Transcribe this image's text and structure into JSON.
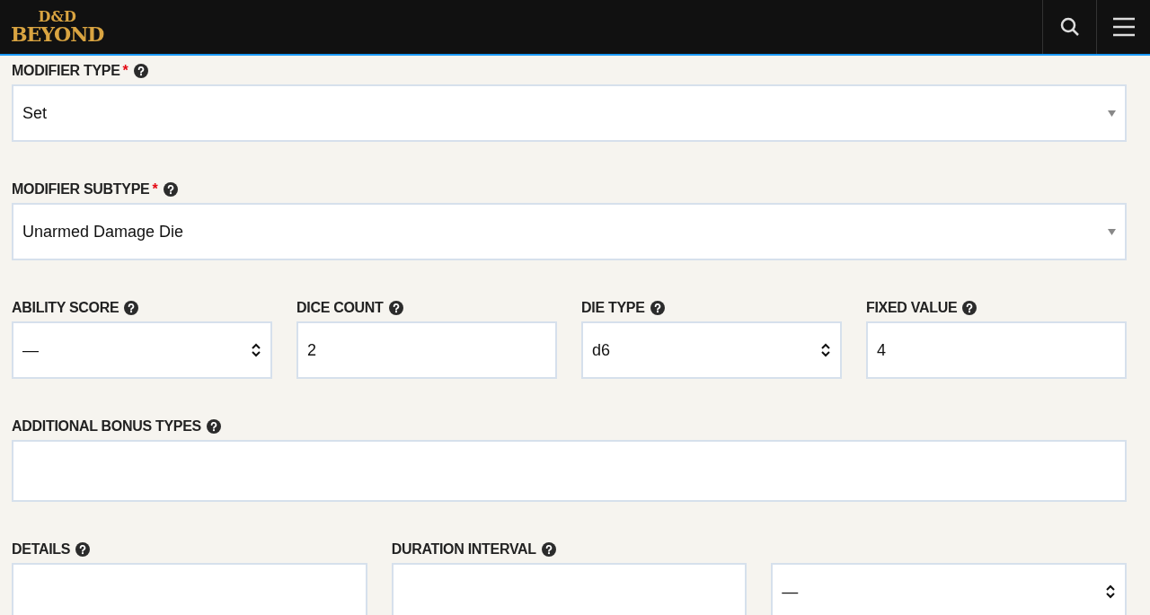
{
  "header": {
    "logo_top": "D&D",
    "logo_bottom": "BEYOND"
  },
  "rows": [
    {
      "fields": [
        {
          "label": "MODIFIER TYPE",
          "required_mark": "*",
          "kind": "dropdown",
          "value": "Set"
        }
      ]
    },
    {
      "fields": [
        {
          "label": "MODIFIER SUBTYPE",
          "required_mark": "*",
          "kind": "dropdown",
          "value": "Unarmed Damage Die"
        }
      ]
    },
    {
      "fields": [
        {
          "label": "ABILITY SCORE",
          "kind": "select",
          "value": "—"
        },
        {
          "label": "DICE COUNT",
          "kind": "input",
          "value": "2"
        },
        {
          "label": "DIE TYPE",
          "kind": "select",
          "value": "d6"
        },
        {
          "label": "FIXED VALUE",
          "kind": "input",
          "value": "4"
        }
      ]
    },
    {
      "fields": [
        {
          "label": "ADDITIONAL BONUS TYPES",
          "kind": "tags"
        }
      ]
    },
    {
      "fields": [
        {
          "label": "DETAILS",
          "kind": "input"
        },
        {
          "label": "DURATION INTERVAL",
          "kind": "input"
        },
        {
          "kind": "select",
          "value": "—"
        }
      ]
    }
  ]
}
